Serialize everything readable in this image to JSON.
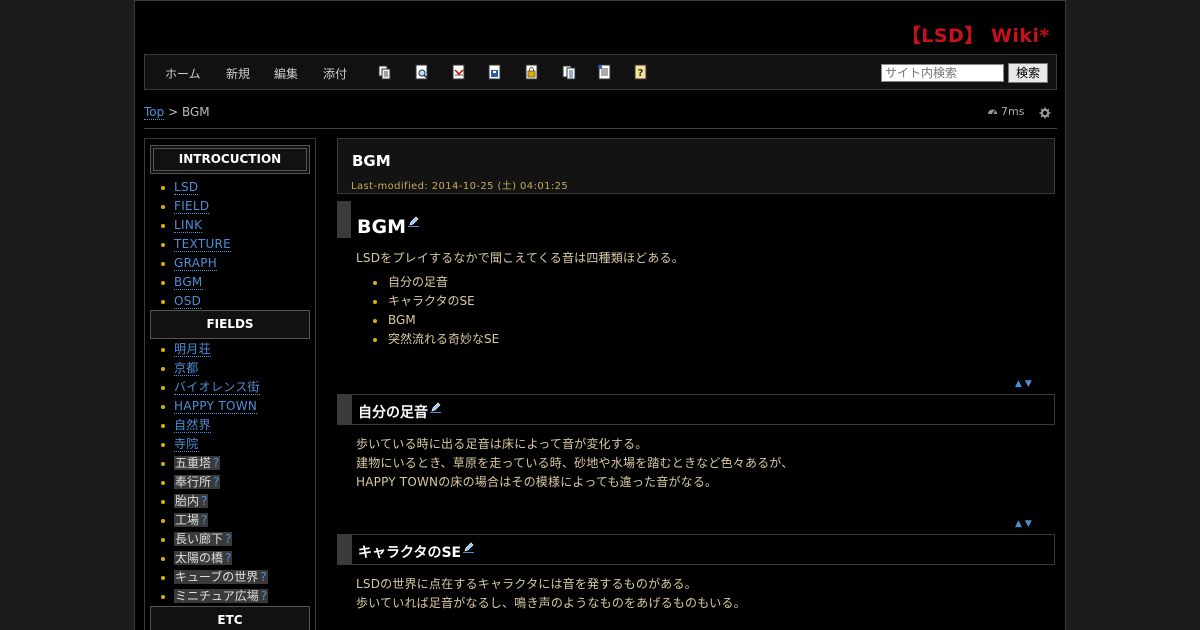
{
  "site": {
    "title": "【LSD】 Wiki*"
  },
  "nav": {
    "home": "ホーム",
    "new": "新規",
    "edit": "編集",
    "attach": "添付",
    "toolbar_icons": [
      "copy-page-icon",
      "search-page-icon",
      "diff-icon",
      "save-icon",
      "lock-icon",
      "list-icon",
      "recent-icon",
      "help-icon"
    ]
  },
  "search": {
    "placeholder": "サイト内検索",
    "button": "検索"
  },
  "breadcrumb": {
    "top": "Top",
    "sep": " > ",
    "current": "BGM"
  },
  "perf": {
    "time": "7ms"
  },
  "sidebar": {
    "intro_head": "INTROCUCTION",
    "intro_items": [
      "LSD",
      "FIELD",
      "LINK",
      "TEXTURE",
      "GRAPH",
      "BGM",
      "OSD"
    ],
    "fields_head": "FIELDS",
    "field_links": [
      "明月荘",
      "京都",
      "バイオレンス街",
      "HAPPY TOWN",
      "自然界",
      "寺院"
    ],
    "field_missing": [
      "五重塔",
      "奉行所",
      "胎内",
      "工場",
      "長い廊下",
      "太陽の橋",
      "キューブの世界",
      "ミニチュア広場"
    ],
    "missing_mark": "?",
    "etc_head": "ETC"
  },
  "page": {
    "title": "BGM",
    "last_modified": "Last-modified: 2014-10-25 (土) 04:01:25",
    "h2": "BGM",
    "intro": "LSDをプレイするなかで聞こえてくる音は四種類ほどある。",
    "bullets": [
      "自分の足音",
      "キャラクタのSE",
      "BGM",
      "突然流れる奇妙なSE"
    ],
    "updown": "▲▼",
    "sec1": {
      "title": "自分の足音",
      "lines": [
        "歩いている時に出る足音は床によって音が変化する。",
        "建物にいるとき、草原を走っている時、砂地や水場を踏むときなど色々あるが、",
        "HAPPY TOWNの床の場合はその模様によっても違った音がなる。"
      ]
    },
    "sec2": {
      "title": "キャラクタのSE",
      "lines": [
        "LSDの世界に点在するキャラクタには音を発するものがある。",
        "歩いていれば足音がなるし、鳴き声のようなものをあげるものもいる。"
      ]
    }
  },
  "colors": {
    "title_red": "#c8101a",
    "link_blue": "#4d8fd6",
    "bullet_gold": "#d9b000",
    "text_tan": "#d8c8a0"
  }
}
